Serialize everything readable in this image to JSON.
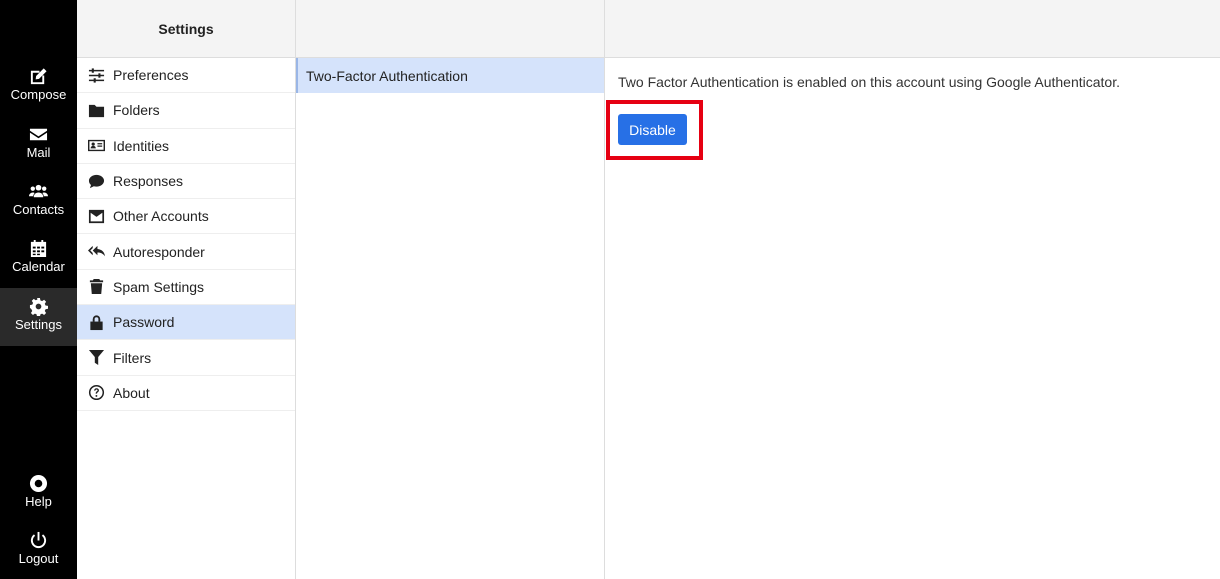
{
  "taskmenu": {
    "compose": "Compose",
    "mail": "Mail",
    "contacts": "Contacts",
    "calendar": "Calendar",
    "settings": "Settings",
    "help": "Help",
    "logout": "Logout"
  },
  "settings": {
    "header": "Settings",
    "items": [
      {
        "label": "Preferences",
        "icon": "sliders-icon"
      },
      {
        "label": "Folders",
        "icon": "folder-icon"
      },
      {
        "label": "Identities",
        "icon": "id-card-icon"
      },
      {
        "label": "Responses",
        "icon": "comment-icon"
      },
      {
        "label": "Other Accounts",
        "icon": "envelope-icon"
      },
      {
        "label": "Autoresponder",
        "icon": "reply-all-icon"
      },
      {
        "label": "Spam Settings",
        "icon": "trash-icon"
      },
      {
        "label": "Password",
        "icon": "lock-icon"
      },
      {
        "label": "Filters",
        "icon": "filter-icon"
      },
      {
        "label": "About",
        "icon": "question-circle-icon"
      }
    ],
    "selected": "Password"
  },
  "sections": {
    "items": [
      {
        "label": "Two-Factor Authentication"
      }
    ]
  },
  "content": {
    "message": "Two Factor Authentication is enabled on this account using Google Authenticator.",
    "disable_label": "Disable"
  },
  "colors": {
    "taskmenu_bg": "#000000",
    "selected_bg": "#d5e3fb",
    "button_bg": "#2770e6",
    "highlight": "#e60012"
  }
}
